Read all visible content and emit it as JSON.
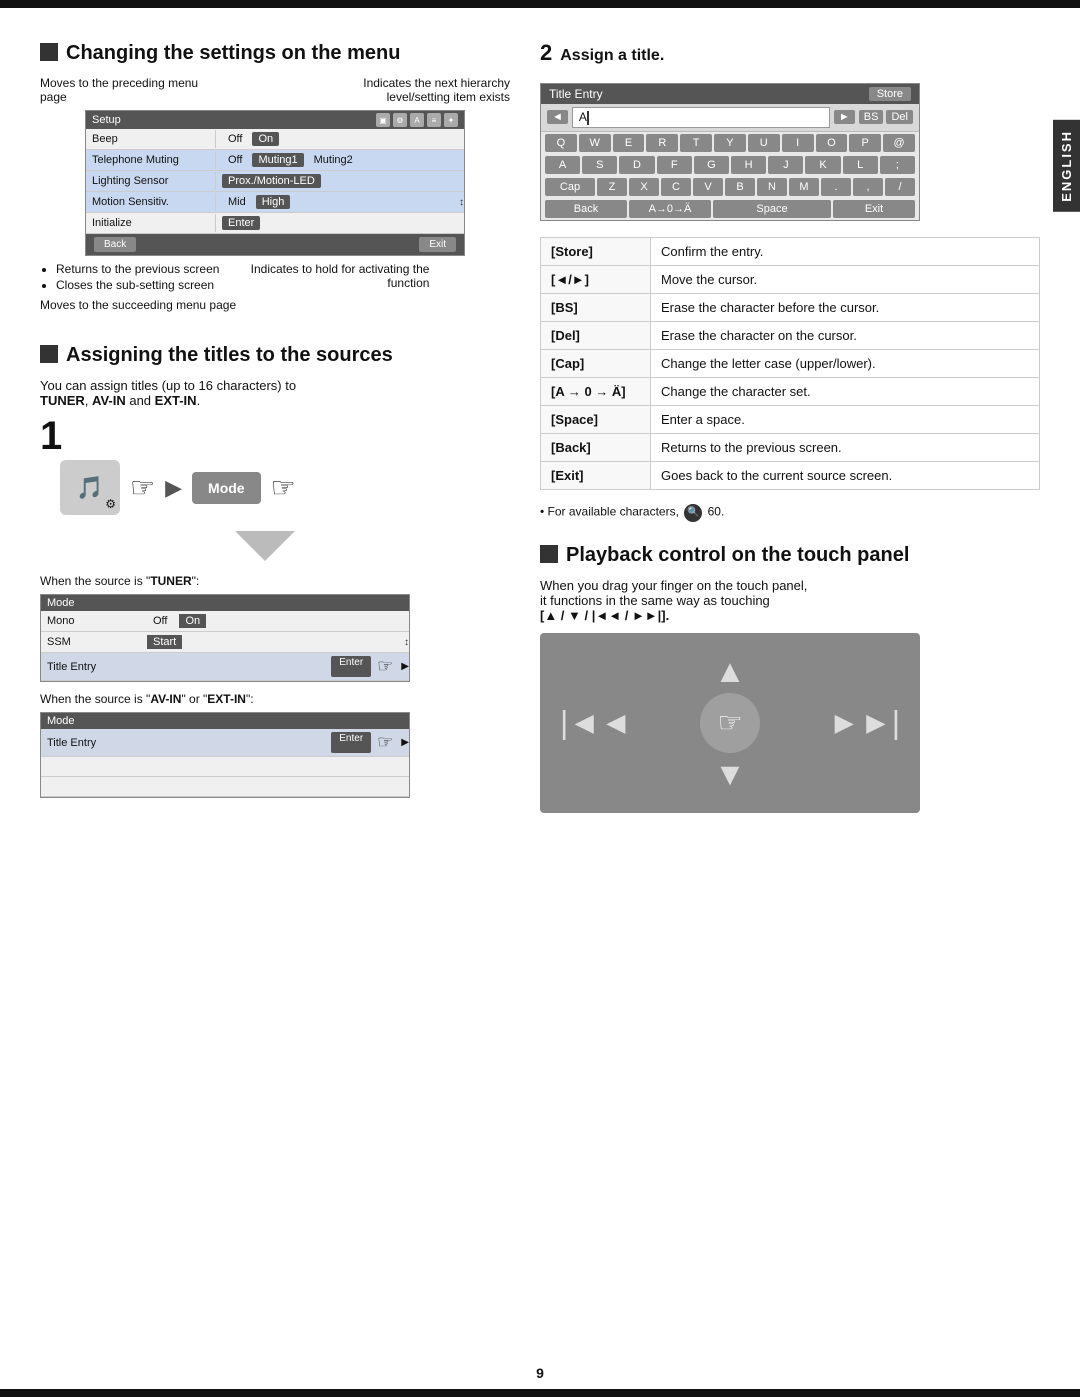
{
  "page": {
    "number": "9",
    "lang_tab": "ENGLISH"
  },
  "section_menu": {
    "title": "Changing the settings on the menu",
    "annotation_left": "Moves to the preceding menu page",
    "annotation_right": "Indicates the next hierarchy level/setting item exists",
    "setup_screen": {
      "header": "Setup",
      "rows": [
        {
          "label": "Beep",
          "values": [
            "Off",
            "On"
          ],
          "selected": 1
        },
        {
          "label": "Telephone Muting",
          "values": [
            "Off",
            "Muting1",
            "Muting2"
          ],
          "selected": 1,
          "highlight": true
        },
        {
          "label": "Lighting Sensor",
          "values": [
            "Prox./Motion-LED"
          ],
          "selected": 0,
          "highlight": true
        },
        {
          "label": "Motion Sensitiv.",
          "values": [
            "Mid",
            "High"
          ],
          "selected": 1,
          "highlight": true
        },
        {
          "label": "Initialize",
          "values": [
            "Enter"
          ],
          "selected": 0
        }
      ],
      "back_btn": "Back",
      "exit_btn": "Exit"
    },
    "bullet1": "Returns to the previous screen",
    "bullet2": "Closes the sub-setting screen",
    "annotation_bottom_left": "Moves to the succeeding menu page",
    "annotation_bottom_right": "Indicates to hold for activating the function"
  },
  "section_assign": {
    "title": "Assigning the titles to the sources",
    "body": "You can assign titles (up to 16 characters) to",
    "sources": "\"TUNER\", \"AV-IN\" and \"EXT-IN\".",
    "step1": "1",
    "when_tuner": "When the source is \"TUNER\":",
    "when_avin": "When the source is \"AV-IN\" or \"EXT-IN\":",
    "mode_screen_tuner": {
      "header": "Mode",
      "rows": [
        {
          "label": "Mono",
          "values": [
            "Off",
            "On"
          ]
        },
        {
          "label": "SSM",
          "values": [
            "Start"
          ]
        },
        {
          "label": "Title Entry",
          "values": [
            "Enter"
          ],
          "enter": true
        }
      ]
    },
    "mode_screen_avin": {
      "header": "Mode",
      "rows": [
        {
          "label": "Title Entry",
          "values": [
            "Enter"
          ],
          "enter": true
        }
      ]
    }
  },
  "section_title_entry": {
    "step2": "2",
    "step2_label": "Assign a title.",
    "keyboard": {
      "header": "Title Entry",
      "store_btn": "Store",
      "input_cursor": "A",
      "row1": [
        "Q",
        "W",
        "E",
        "R",
        "T",
        "Y",
        "U",
        "I",
        "O",
        "P",
        "@"
      ],
      "row2": [
        "A",
        "S",
        "D",
        "F",
        "G",
        "H",
        "J",
        "K",
        "L",
        ";"
      ],
      "row3": [
        "Cap",
        "Z",
        "X",
        "C",
        "V",
        "B",
        "N",
        "M",
        ".",
        ",",
        "/"
      ],
      "back_btn": "Back",
      "charset_btn": "A→0→Ä",
      "space_btn": "Space",
      "exit_btn": "Exit"
    },
    "key_table": [
      {
        "key": "[Store]",
        "desc": "Confirm the entry."
      },
      {
        "key": "[◄/►]",
        "desc": "Move the cursor."
      },
      {
        "key": "[BS]",
        "desc": "Erase the character before the cursor."
      },
      {
        "key": "[Del]",
        "desc": "Erase the character on the cursor."
      },
      {
        "key": "[Cap]",
        "desc": "Change the letter case (upper/lower)."
      },
      {
        "key": "[A → 0 → Ä]",
        "desc": "Change the character set."
      },
      {
        "key": "[Space]",
        "desc": "Enter a space."
      },
      {
        "key": "[Back]",
        "desc": "Returns to the previous screen."
      },
      {
        "key": "[Exit]",
        "desc": "Goes back to the current source screen."
      }
    ],
    "available_note": "For available characters,",
    "available_page": "60."
  },
  "section_playback": {
    "title": "Playback control on the touch panel",
    "body1": "When you drag your finger on the touch panel,",
    "body2": "it functions in the same way as touching",
    "arrows": "[▲ / ▼ / |◄◄ / ►►|]."
  }
}
